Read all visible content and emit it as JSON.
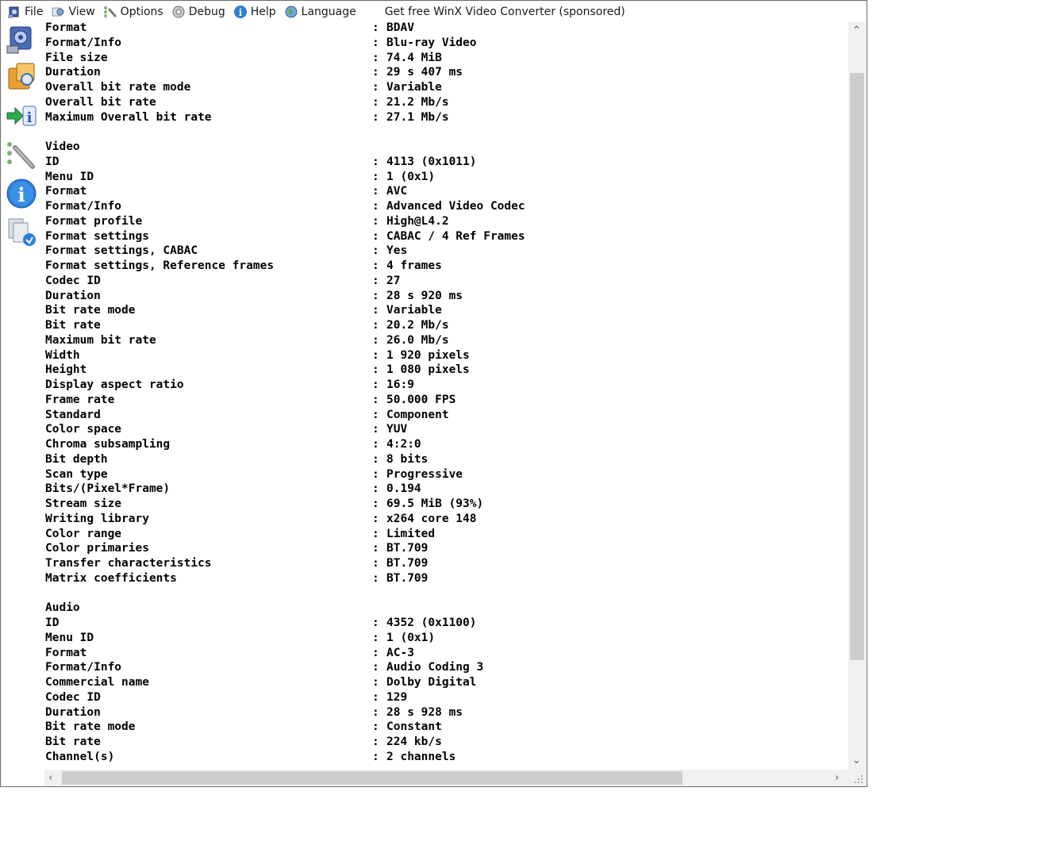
{
  "menu": {
    "file": "File",
    "view": "View",
    "options": "Options",
    "debug": "Debug",
    "help": "Help",
    "language": "Language",
    "sponsored": "Get free WinX Video Converter (sponsored)"
  },
  "lines": [
    [
      "Format",
      "BDAV"
    ],
    [
      "Format/Info",
      "Blu-ray Video"
    ],
    [
      "File size",
      "74.4 MiB"
    ],
    [
      "Duration",
      "29 s 407 ms"
    ],
    [
      "Overall bit rate mode",
      "Variable"
    ],
    [
      "Overall bit rate",
      "21.2 Mb/s"
    ],
    [
      "Maximum Overall bit rate",
      "27.1 Mb/s"
    ],
    [
      "",
      ""
    ],
    [
      "Video",
      ""
    ],
    [
      "ID",
      "4113 (0x1011)"
    ],
    [
      "Menu ID",
      "1 (0x1)"
    ],
    [
      "Format",
      "AVC"
    ],
    [
      "Format/Info",
      "Advanced Video Codec"
    ],
    [
      "Format profile",
      "High@L4.2"
    ],
    [
      "Format settings",
      "CABAC / 4 Ref Frames"
    ],
    [
      "Format settings, CABAC",
      "Yes"
    ],
    [
      "Format settings, Reference frames",
      "4 frames"
    ],
    [
      "Codec ID",
      "27"
    ],
    [
      "Duration",
      "28 s 920 ms"
    ],
    [
      "Bit rate mode",
      "Variable"
    ],
    [
      "Bit rate",
      "20.2 Mb/s"
    ],
    [
      "Maximum bit rate",
      "26.0 Mb/s"
    ],
    [
      "Width",
      "1 920 pixels"
    ],
    [
      "Height",
      "1 080 pixels"
    ],
    [
      "Display aspect ratio",
      "16:9"
    ],
    [
      "Frame rate",
      "50.000 FPS"
    ],
    [
      "Standard",
      "Component"
    ],
    [
      "Color space",
      "YUV"
    ],
    [
      "Chroma subsampling",
      "4:2:0"
    ],
    [
      "Bit depth",
      "8 bits"
    ],
    [
      "Scan type",
      "Progressive"
    ],
    [
      "Bits/(Pixel*Frame)",
      "0.194"
    ],
    [
      "Stream size",
      "69.5 MiB (93%)"
    ],
    [
      "Writing library",
      "x264 core 148"
    ],
    [
      "Color range",
      "Limited"
    ],
    [
      "Color primaries",
      "BT.709"
    ],
    [
      "Transfer characteristics",
      "BT.709"
    ],
    [
      "Matrix coefficients",
      "BT.709"
    ],
    [
      "",
      ""
    ],
    [
      "Audio",
      ""
    ],
    [
      "ID",
      "4352 (0x1100)"
    ],
    [
      "Menu ID",
      "1 (0x1)"
    ],
    [
      "Format",
      "AC-3"
    ],
    [
      "Format/Info",
      "Audio Coding 3"
    ],
    [
      "Commercial name",
      "Dolby Digital"
    ],
    [
      "Codec ID",
      "129"
    ],
    [
      "Duration",
      "28 s 928 ms"
    ],
    [
      "Bit rate mode",
      "Constant"
    ],
    [
      "Bit rate",
      "224 kb/s"
    ],
    [
      "Channel(s)",
      "2 channels"
    ]
  ],
  "separator": ":",
  "icons": {
    "sidebar": [
      "sheet-view-icon",
      "html-view-icon",
      "export-icon",
      "preferences-icon",
      "about-icon",
      "new-version-icon"
    ]
  }
}
